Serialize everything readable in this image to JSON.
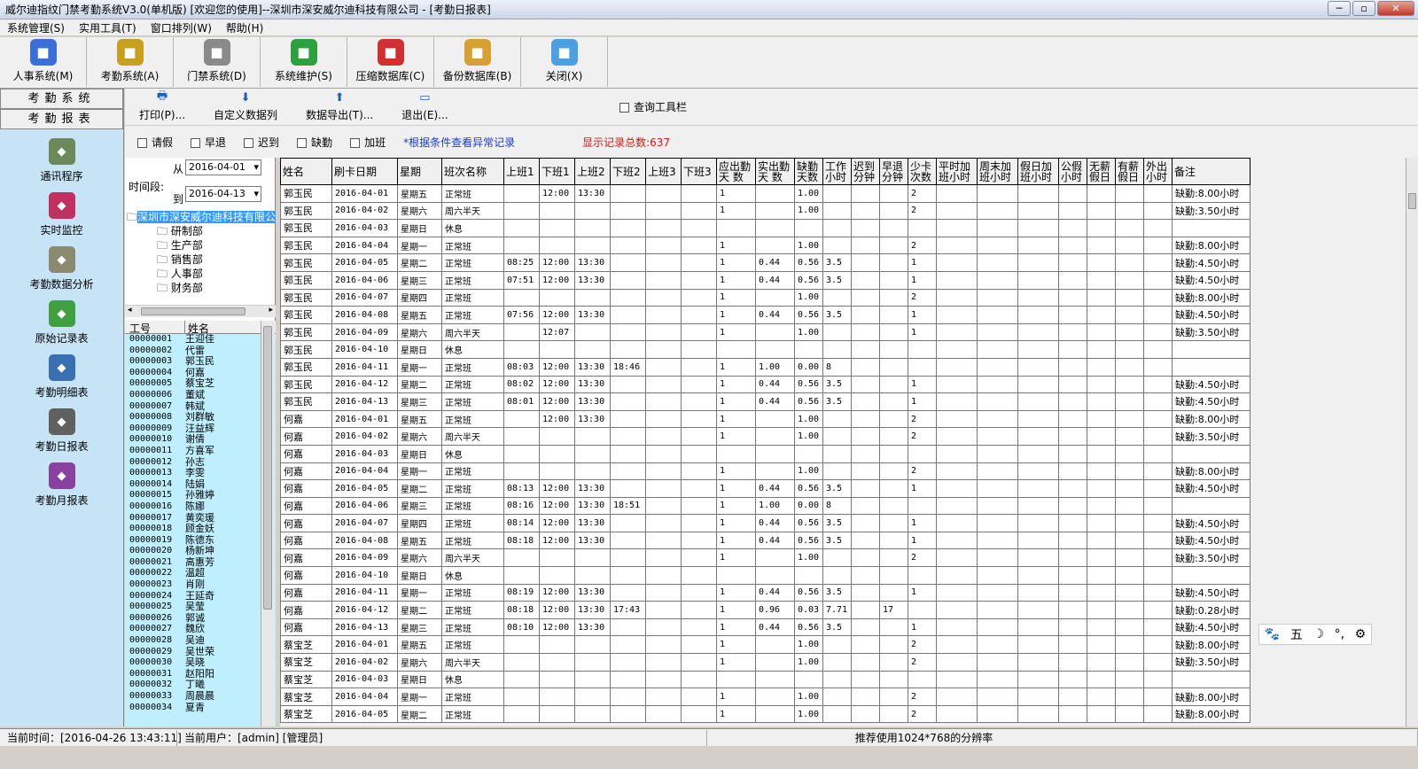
{
  "window": {
    "title": "威尔迪指纹门禁考勤系统V3.0(单机版) [欢迎您的使用]--深圳市深安威尔迪科技有限公司 - [考勤日报表]"
  },
  "menu": [
    "系统管理(S)",
    "实用工具(T)",
    "窗口排列(W)",
    "帮助(H)"
  ],
  "toolbar": [
    {
      "label": "人事系统(M)",
      "icon": "people-icon",
      "color": "#3a6fd8"
    },
    {
      "label": "考勤系统(A)",
      "icon": "clock-icon",
      "color": "#c8a020"
    },
    {
      "label": "门禁系统(D)",
      "icon": "door-icon",
      "color": "#8a8a8a"
    },
    {
      "label": "系统维护(S)",
      "icon": "recycle-icon",
      "color": "#2fa040"
    },
    {
      "label": "压缩数据库(C)",
      "icon": "compress-icon",
      "color": "#d03030"
    },
    {
      "label": "备份数据库(B)",
      "icon": "floppy-icon",
      "color": "#d8a030"
    },
    {
      "label": "关闭(X)",
      "icon": "close-window-icon",
      "color": "#4aa0e0"
    }
  ],
  "nav": {
    "header1": "考勤系统",
    "header2": "考勤报表",
    "items": [
      {
        "label": "通讯程序",
        "icon": "communication-icon",
        "color": "#6a8a5a"
      },
      {
        "label": "实时监控",
        "icon": "monitor-cubes-icon",
        "color": "#c03060"
      },
      {
        "label": "考勤数据分析",
        "icon": "disc-icon",
        "color": "#8a8a70"
      },
      {
        "label": "原始记录表",
        "icon": "book-icon",
        "color": "#40a040"
      },
      {
        "label": "考勤明细表",
        "icon": "screen-icon",
        "color": "#3a70b0"
      },
      {
        "label": "考勤日报表",
        "icon": "calendar-icon",
        "color": "#606060"
      },
      {
        "label": "考勤月报表",
        "icon": "report-icon",
        "color": "#8a40a0"
      }
    ]
  },
  "report_toolbar": {
    "print": "打印(P)...",
    "custom": "自定义数据列",
    "export": "数据导出(T)...",
    "exit": "退出(E)...",
    "query": "查询工具栏"
  },
  "filters": {
    "leave": "请假",
    "early": "早退",
    "late": "迟到",
    "absent": "缺勤",
    "overtime": "加班",
    "hint": "*根据条件查看异常记录",
    "total": "显示记录总数:637"
  },
  "period": {
    "label": "时间段:",
    "from_label": "从",
    "to_label": "到",
    "from": "2016-04-01",
    "to": "2016-04-13"
  },
  "tree": {
    "company": "深圳市深安威尔迪科技有限公",
    "departments": [
      "研制部",
      "生产部",
      "销售部",
      "人事部",
      "财务部"
    ]
  },
  "employees": {
    "col_id": "工号",
    "col_name": "姓名",
    "rows": [
      [
        "00000001",
        "王迎佳"
      ],
      [
        "00000002",
        "代雷"
      ],
      [
        "00000003",
        "郭玉民"
      ],
      [
        "00000004",
        "何嘉"
      ],
      [
        "00000005",
        "蔡宝芝"
      ],
      [
        "00000006",
        "董斌"
      ],
      [
        "00000007",
        "韩斌"
      ],
      [
        "00000008",
        "刘群敏"
      ],
      [
        "00000009",
        "汪益辉"
      ],
      [
        "00000010",
        "谢倩"
      ],
      [
        "00000011",
        "方喜军"
      ],
      [
        "00000012",
        "孙志"
      ],
      [
        "00000013",
        "李雯"
      ],
      [
        "00000014",
        "陆娟"
      ],
      [
        "00000015",
        "孙雅婷"
      ],
      [
        "00000016",
        "陈娜"
      ],
      [
        "00000017",
        "黄奕瑗"
      ],
      [
        "00000018",
        "顾金妖"
      ],
      [
        "00000019",
        "陈德东"
      ],
      [
        "00000020",
        "杨新坤"
      ],
      [
        "00000021",
        "高惠芳"
      ],
      [
        "00000022",
        "温超"
      ],
      [
        "00000023",
        "肖刚"
      ],
      [
        "00000024",
        "王延奇"
      ],
      [
        "00000025",
        "吴莹"
      ],
      [
        "00000026",
        "郭诚"
      ],
      [
        "00000027",
        "魏欣"
      ],
      [
        "00000028",
        "吴迪"
      ],
      [
        "00000029",
        "吴世荣"
      ],
      [
        "00000030",
        "吴晓"
      ],
      [
        "00000031",
        "赵阳阳"
      ],
      [
        "00000032",
        "丁曦"
      ],
      [
        "00000033",
        "周晨晨"
      ],
      [
        "00000034",
        "夏青"
      ]
    ]
  },
  "table": {
    "columns": [
      "姓名",
      "刷卡日期",
      "星期",
      "班次名称",
      "上班1",
      "下班1",
      "上班2",
      "下班2",
      "上班3",
      "下班3",
      "应出勤天 数",
      "实出勤天 数",
      "缺勤天数",
      "工作小时",
      "迟到分钟",
      "早退分钟",
      "少卡次数",
      "平时加班小时",
      "周末加班小时",
      "假日加班小时",
      "公假小时",
      "无薪假日",
      "有薪假日",
      "外出小时",
      "备注"
    ],
    "rows": [
      [
        "郭玉民",
        "2016-04-01",
        "星期五",
        "正常班",
        "",
        "12:00",
        "13:30",
        "",
        "",
        "",
        "1",
        "",
        "1.00",
        "",
        "",
        "",
        "2",
        "",
        "",
        "",
        "",
        "",
        "",
        "",
        "缺勤:8.00小时"
      ],
      [
        "郭玉民",
        "2016-04-02",
        "星期六",
        "周六半天",
        "",
        "",
        "",
        "",
        "",
        "",
        "1",
        "",
        "1.00",
        "",
        "",
        "",
        "2",
        "",
        "",
        "",
        "",
        "",
        "",
        "",
        "缺勤:3.50小时"
      ],
      [
        "郭玉民",
        "2016-04-03",
        "星期日",
        "休息",
        "",
        "",
        "",
        "",
        "",
        "",
        "",
        "",
        "",
        "",
        "",
        "",
        "",
        "",
        "",
        "",
        "",
        "",
        "",
        "",
        ""
      ],
      [
        "郭玉民",
        "2016-04-04",
        "星期一",
        "正常班",
        "",
        "",
        "",
        "",
        "",
        "",
        "1",
        "",
        "1.00",
        "",
        "",
        "",
        "2",
        "",
        "",
        "",
        "",
        "",
        "",
        "",
        "缺勤:8.00小时"
      ],
      [
        "郭玉民",
        "2016-04-05",
        "星期二",
        "正常班",
        "08:25",
        "12:00",
        "13:30",
        "",
        "",
        "",
        "1",
        "0.44",
        "0.56",
        "3.5",
        "",
        "",
        "1",
        "",
        "",
        "",
        "",
        "",
        "",
        "",
        "缺勤:4.50小时"
      ],
      [
        "郭玉民",
        "2016-04-06",
        "星期三",
        "正常班",
        "07:51",
        "12:00",
        "13:30",
        "",
        "",
        "",
        "1",
        "0.44",
        "0.56",
        "3.5",
        "",
        "",
        "1",
        "",
        "",
        "",
        "",
        "",
        "",
        "",
        "缺勤:4.50小时"
      ],
      [
        "郭玉民",
        "2016-04-07",
        "星期四",
        "正常班",
        "",
        "",
        "",
        "",
        "",
        "",
        "1",
        "",
        "1.00",
        "",
        "",
        "",
        "2",
        "",
        "",
        "",
        "",
        "",
        "",
        "",
        "缺勤:8.00小时"
      ],
      [
        "郭玉民",
        "2016-04-08",
        "星期五",
        "正常班",
        "07:56",
        "12:00",
        "13:30",
        "",
        "",
        "",
        "1",
        "0.44",
        "0.56",
        "3.5",
        "",
        "",
        "1",
        "",
        "",
        "",
        "",
        "",
        "",
        "",
        "缺勤:4.50小时"
      ],
      [
        "郭玉民",
        "2016-04-09",
        "星期六",
        "周六半天",
        "",
        "12:07",
        "",
        "",
        "",
        "",
        "1",
        "",
        "1.00",
        "",
        "",
        "",
        "1",
        "",
        "",
        "",
        "",
        "",
        "",
        "",
        "缺勤:3.50小时"
      ],
      [
        "郭玉民",
        "2016-04-10",
        "星期日",
        "休息",
        "",
        "",
        "",
        "",
        "",
        "",
        "",
        "",
        "",
        "",
        "",
        "",
        "",
        "",
        "",
        "",
        "",
        "",
        "",
        "",
        ""
      ],
      [
        "郭玉民",
        "2016-04-11",
        "星期一",
        "正常班",
        "08:03",
        "12:00",
        "13:30",
        "18:46",
        "",
        "",
        "1",
        "1.00",
        "0.00",
        "8",
        "",
        "",
        "",
        "",
        "",
        "",
        "",
        "",
        "",
        "",
        ""
      ],
      [
        "郭玉民",
        "2016-04-12",
        "星期二",
        "正常班",
        "08:02",
        "12:00",
        "13:30",
        "",
        "",
        "",
        "1",
        "0.44",
        "0.56",
        "3.5",
        "",
        "",
        "1",
        "",
        "",
        "",
        "",
        "",
        "",
        "",
        "缺勤:4.50小时"
      ],
      [
        "郭玉民",
        "2016-04-13",
        "星期三",
        "正常班",
        "08:01",
        "12:00",
        "13:30",
        "",
        "",
        "",
        "1",
        "0.44",
        "0.56",
        "3.5",
        "",
        "",
        "1",
        "",
        "",
        "",
        "",
        "",
        "",
        "",
        "缺勤:4.50小时"
      ],
      [
        "何嘉",
        "2016-04-01",
        "星期五",
        "正常班",
        "",
        "12:00",
        "13:30",
        "",
        "",
        "",
        "1",
        "",
        "1.00",
        "",
        "",
        "",
        "2",
        "",
        "",
        "",
        "",
        "",
        "",
        "",
        "缺勤:8.00小时"
      ],
      [
        "何嘉",
        "2016-04-02",
        "星期六",
        "周六半天",
        "",
        "",
        "",
        "",
        "",
        "",
        "1",
        "",
        "1.00",
        "",
        "",
        "",
        "2",
        "",
        "",
        "",
        "",
        "",
        "",
        "",
        "缺勤:3.50小时"
      ],
      [
        "何嘉",
        "2016-04-03",
        "星期日",
        "休息",
        "",
        "",
        "",
        "",
        "",
        "",
        "",
        "",
        "",
        "",
        "",
        "",
        "",
        "",
        "",
        "",
        "",
        "",
        "",
        "",
        ""
      ],
      [
        "何嘉",
        "2016-04-04",
        "星期一",
        "正常班",
        "",
        "",
        "",
        "",
        "",
        "",
        "1",
        "",
        "1.00",
        "",
        "",
        "",
        "2",
        "",
        "",
        "",
        "",
        "",
        "",
        "",
        "缺勤:8.00小时"
      ],
      [
        "何嘉",
        "2016-04-05",
        "星期二",
        "正常班",
        "08:13",
        "12:00",
        "13:30",
        "",
        "",
        "",
        "1",
        "0.44",
        "0.56",
        "3.5",
        "",
        "",
        "1",
        "",
        "",
        "",
        "",
        "",
        "",
        "",
        "缺勤:4.50小时"
      ],
      [
        "何嘉",
        "2016-04-06",
        "星期三",
        "正常班",
        "08:16",
        "12:00",
        "13:30",
        "18:51",
        "",
        "",
        "1",
        "1.00",
        "0.00",
        "8",
        "",
        "",
        "",
        "",
        "",
        "",
        "",
        "",
        "",
        "",
        ""
      ],
      [
        "何嘉",
        "2016-04-07",
        "星期四",
        "正常班",
        "08:14",
        "12:00",
        "13:30",
        "",
        "",
        "",
        "1",
        "0.44",
        "0.56",
        "3.5",
        "",
        "",
        "1",
        "",
        "",
        "",
        "",
        "",
        "",
        "",
        "缺勤:4.50小时"
      ],
      [
        "何嘉",
        "2016-04-08",
        "星期五",
        "正常班",
        "08:18",
        "12:00",
        "13:30",
        "",
        "",
        "",
        "1",
        "0.44",
        "0.56",
        "3.5",
        "",
        "",
        "1",
        "",
        "",
        "",
        "",
        "",
        "",
        "",
        "缺勤:4.50小时"
      ],
      [
        "何嘉",
        "2016-04-09",
        "星期六",
        "周六半天",
        "",
        "",
        "",
        "",
        "",
        "",
        "1",
        "",
        "1.00",
        "",
        "",
        "",
        "2",
        "",
        "",
        "",
        "",
        "",
        "",
        "",
        "缺勤:3.50小时"
      ],
      [
        "何嘉",
        "2016-04-10",
        "星期日",
        "休息",
        "",
        "",
        "",
        "",
        "",
        "",
        "",
        "",
        "",
        "",
        "",
        "",
        "",
        "",
        "",
        "",
        "",
        "",
        "",
        "",
        ""
      ],
      [
        "何嘉",
        "2016-04-11",
        "星期一",
        "正常班",
        "08:19",
        "12:00",
        "13:30",
        "",
        "",
        "",
        "1",
        "0.44",
        "0.56",
        "3.5",
        "",
        "",
        "1",
        "",
        "",
        "",
        "",
        "",
        "",
        "",
        "缺勤:4.50小时"
      ],
      [
        "何嘉",
        "2016-04-12",
        "星期二",
        "正常班",
        "08:18",
        "12:00",
        "13:30",
        "17:43",
        "",
        "",
        "1",
        "0.96",
        "0.03",
        "7.71",
        "",
        "17",
        "",
        "",
        "",
        "",
        "",
        "",
        "",
        "",
        "缺勤:0.28小时"
      ],
      [
        "何嘉",
        "2016-04-13",
        "星期三",
        "正常班",
        "08:10",
        "12:00",
        "13:30",
        "",
        "",
        "",
        "1",
        "0.44",
        "0.56",
        "3.5",
        "",
        "",
        "1",
        "",
        "",
        "",
        "",
        "",
        "",
        "",
        "缺勤:4.50小时"
      ],
      [
        "蔡宝芝",
        "2016-04-01",
        "星期五",
        "正常班",
        "",
        "",
        "",
        "",
        "",
        "",
        "1",
        "",
        "1.00",
        "",
        "",
        "",
        "2",
        "",
        "",
        "",
        "",
        "",
        "",
        "",
        "缺勤:8.00小时"
      ],
      [
        "蔡宝芝",
        "2016-04-02",
        "星期六",
        "周六半天",
        "",
        "",
        "",
        "",
        "",
        "",
        "1",
        "",
        "1.00",
        "",
        "",
        "",
        "2",
        "",
        "",
        "",
        "",
        "",
        "",
        "",
        "缺勤:3.50小时"
      ],
      [
        "蔡宝芝",
        "2016-04-03",
        "星期日",
        "休息",
        "",
        "",
        "",
        "",
        "",
        "",
        "",
        "",
        "",
        "",
        "",
        "",
        "",
        "",
        "",
        "",
        "",
        "",
        "",
        "",
        ""
      ],
      [
        "蔡宝芝",
        "2016-04-04",
        "星期一",
        "正常班",
        "",
        "",
        "",
        "",
        "",
        "",
        "1",
        "",
        "1.00",
        "",
        "",
        "",
        "2",
        "",
        "",
        "",
        "",
        "",
        "",
        "",
        "缺勤:8.00小时"
      ],
      [
        "蔡宝芝",
        "2016-04-05",
        "星期二",
        "正常班",
        "",
        "",
        "",
        "",
        "",
        "",
        "1",
        "",
        "1.00",
        "",
        "",
        "",
        "2",
        "",
        "",
        "",
        "",
        "",
        "",
        "",
        "缺勤:8.00小时"
      ]
    ]
  },
  "status": {
    "time": "当前时间：[2016-04-26 13:43:11]",
    "user": "当前用户：[admin] [管理员]",
    "tip": "推荐使用1024*768的分辨率"
  },
  "ime": [
    "🐾",
    "五",
    "☽",
    "°,",
    "⚙"
  ]
}
